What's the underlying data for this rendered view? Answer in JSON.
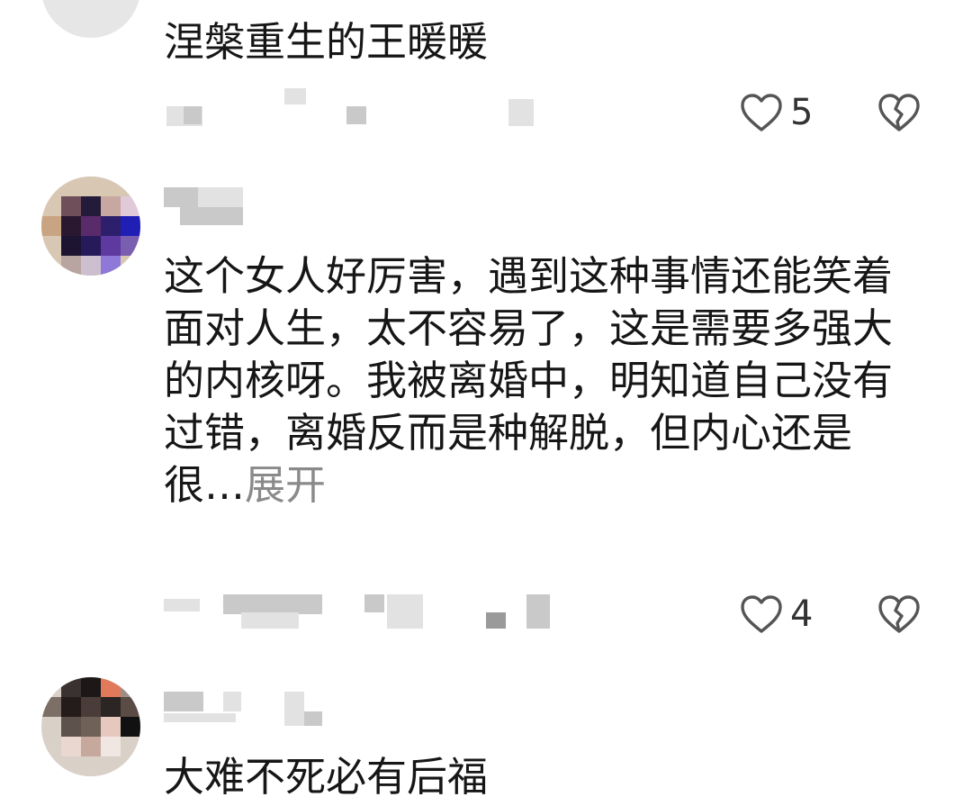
{
  "comments": [
    {
      "text": "涅槃重生的王暖暖",
      "likes": "5",
      "expand": ""
    },
    {
      "text": "这个女人好厉害，遇到这种事情还能笑着面对人生，太不容易了，这是需要多强大的内核呀。我被离婚中，明知道自己没有过错，离婚反而是种解脱，但内心还是很…",
      "likes": "4",
      "expand": "展开"
    },
    {
      "text": "大难不死必有后福",
      "likes": "",
      "expand": ""
    }
  ],
  "icons": {
    "like": "heart-outline-icon",
    "dislike": "broken-heart-icon"
  },
  "colors": {
    "text": "#161616",
    "secondary": "#8a8a8a",
    "icon": "#555555"
  }
}
